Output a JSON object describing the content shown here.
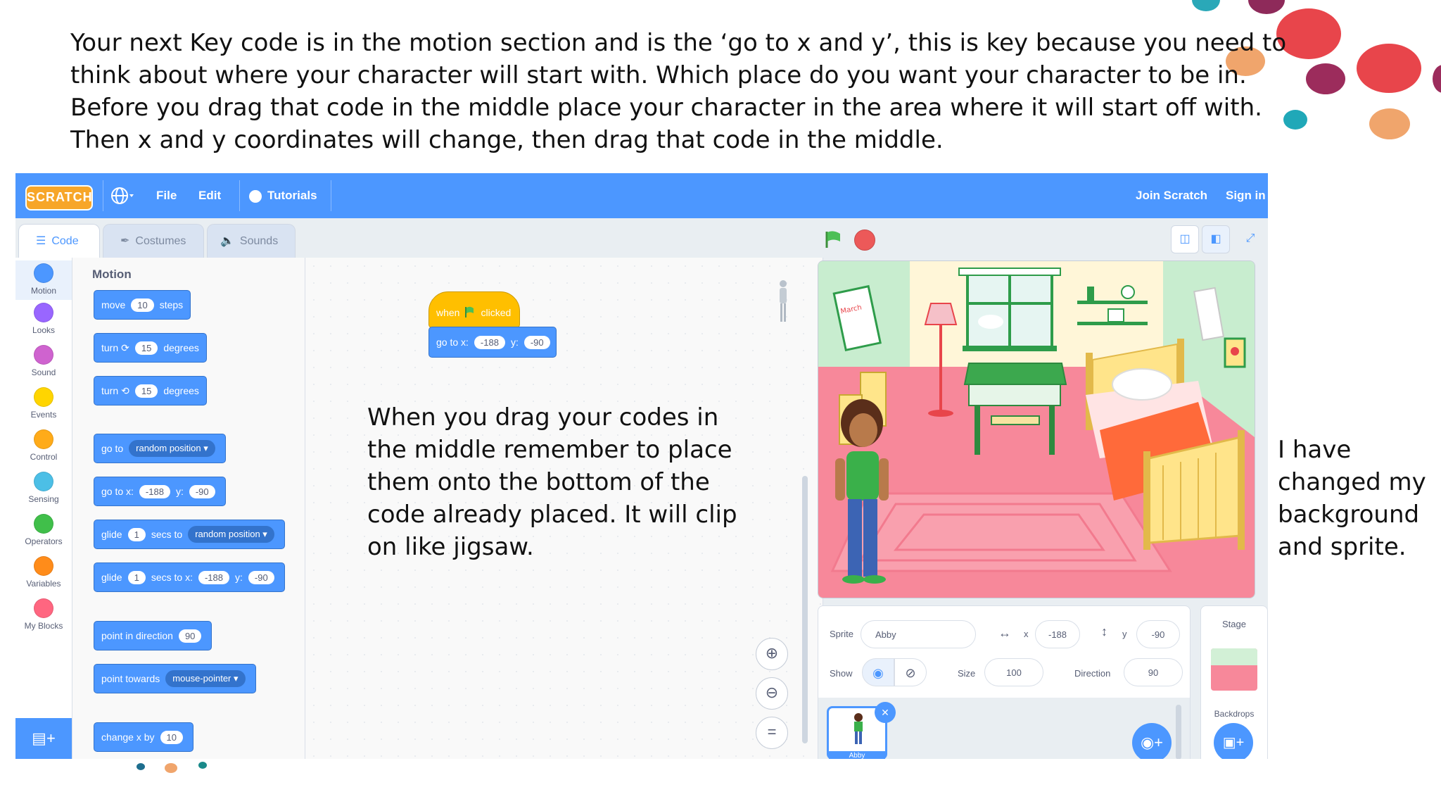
{
  "intro_text": [
    "Your next Key code is in the motion section and is the ‘go to x and y’, this is key because you need to",
    "think about where your character will start with. Which place do you want your character to be in.",
    "Before you drag that code in the middle place your character in the area where it will start off with.",
    "Then x and y coordinates will change, then drag that code in the middle."
  ],
  "middle_note": [
    "When you drag your codes in",
    "the middle remember to place",
    "them onto the bottom of the",
    "code already placed. It will clip",
    "on like  jigsaw."
  ],
  "right_note": [
    "I have",
    "changed my",
    "background",
    "and sprite."
  ],
  "scratch": {
    "logo": "SCRATCH",
    "menu": {
      "file": "File",
      "edit": "Edit",
      "tutorials": "Tutorials",
      "join": "Join Scratch",
      "signin": "Sign in"
    },
    "tabs": {
      "code": "Code",
      "costumes": "Costumes",
      "sounds": "Sounds"
    },
    "categories": [
      {
        "label": "Motion",
        "color": "#4c97ff"
      },
      {
        "label": "Looks",
        "color": "#9966ff"
      },
      {
        "label": "Sound",
        "color": "#cf63cf"
      },
      {
        "label": "Events",
        "color": "#ffd500"
      },
      {
        "label": "Control",
        "color": "#ffab19"
      },
      {
        "label": "Sensing",
        "color": "#4cbfe6"
      },
      {
        "label": "Operators",
        "color": "#40bf4a"
      },
      {
        "label": "Variables",
        "color": "#ff8c1a"
      },
      {
        "label": "My Blocks",
        "color": "#ff6680"
      }
    ],
    "palette_title": "Motion",
    "blocks": {
      "move": {
        "a": "move",
        "v": "10",
        "b": "steps"
      },
      "turn_right": {
        "a": "turn",
        "v": "15",
        "b": "degrees"
      },
      "turn_left": {
        "a": "turn",
        "v": "15",
        "b": "degrees"
      },
      "goto_random": {
        "a": "go to",
        "d": "random position ▾"
      },
      "goto_xy": {
        "a": "go to x:",
        "x": "-188",
        "b": "y:",
        "y": "-90"
      },
      "glide_random": {
        "a": "glide",
        "v": "1",
        "b": "secs to",
        "d": "random position ▾"
      },
      "glide_xy": {
        "a": "glide",
        "v": "1",
        "b": "secs to x:",
        "x": "-188",
        "c": "y:",
        "y": "-90"
      },
      "point_dir": {
        "a": "point in direction",
        "v": "90"
      },
      "point_towards": {
        "a": "point towards",
        "d": "mouse-pointer ▾"
      },
      "change_x": {
        "a": "change x by",
        "v": "10"
      }
    },
    "workspace": {
      "hat_when": "when",
      "hat_clicked": "clicked",
      "goto_label": "go to x:",
      "goto_x": "-188",
      "goto_y_label": "y:",
      "goto_y": "-90"
    },
    "sprite_info": {
      "sprite_label": "Sprite",
      "sprite_name": "Abby",
      "x_label": "x",
      "x": "-188",
      "y_label": "y",
      "y": "-90",
      "show_label": "Show",
      "size_label": "Size",
      "size": "100",
      "direction_label": "Direction",
      "direction": "90",
      "thumb_name": "Abby"
    },
    "stage_pane": {
      "title": "Stage",
      "backdrops": "Backdrops"
    },
    "calendar_text": "March"
  }
}
